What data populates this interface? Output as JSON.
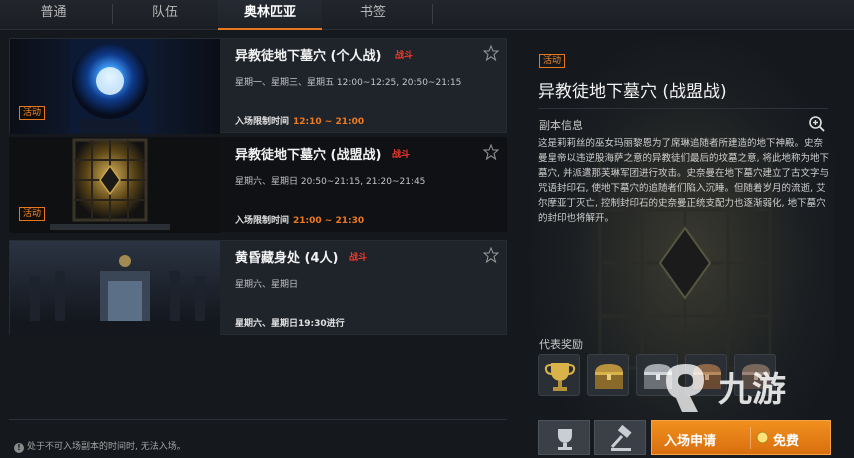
{
  "tabs": [
    {
      "label": "普通",
      "active": false
    },
    {
      "label": "队伍",
      "active": false
    },
    {
      "label": "奥林匹亚",
      "active": true
    },
    {
      "label": "书签",
      "active": false
    }
  ],
  "dungeons": [
    {
      "title": "异教徒地下墓穴 (个人战)",
      "tag": "战斗",
      "badge": "活动",
      "schedule": "星期一、星期三、星期五  12:00~12:25, 20:50~21:15",
      "limit_label": "入场限制时间",
      "limit_time": "12:10 ~ 21:00"
    },
    {
      "title": "异教徒地下墓穴 (战盟战)",
      "tag": "战斗",
      "badge": "活动",
      "schedule": "星期六、星期日  20:50~21:15, 21:20~21:45",
      "limit_label": "入场限制时间",
      "limit_time": "21:00 ~ 21:30"
    },
    {
      "title": "黄昏藏身处 (4人)",
      "tag": "战斗",
      "badge": "",
      "schedule": "星期六、星期日",
      "limit_label": "星期六、星期日19:30进行",
      "limit_time": ""
    }
  ],
  "notice": "处于不可入场副本的时间时, 无法入场。",
  "detail": {
    "badge": "活动",
    "title": "异教徒地下墓穴 (战盟战)",
    "section_label": "副本信息",
    "description": "这是莉莉丝的巫女玛丽黎恩为了席琳追随者所建造的地下神殿。史奈曼皇帝以违逆股海萨之意的异教徒们最后的坟墓之意, 将此地称为地下墓穴, 并派遣那芙琳军团进行攻击。史奈曼在地下墓穴建立了古文字与咒语封印石, 使地下墓穴的追随者们陷入沉睡。但随着岁月的流逝, 艾尔摩亚丁灭亡, 控制封印石的史奈曼正统支配力也逐渐弱化, 地下墓穴的封印也将解开。",
    "reward_label": "代表奖励",
    "enter_label": "入场申请",
    "free_label": "免费"
  },
  "watermark": "九游",
  "colors": {
    "accent": "#e7771c",
    "tag_red": "#ef3a2b",
    "highlight": "#ef7a1e"
  }
}
